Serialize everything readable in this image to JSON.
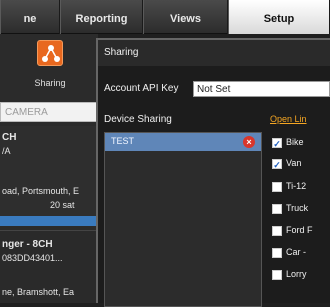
{
  "tabs": {
    "home": "ne",
    "reporting": "Reporting",
    "views": "Views",
    "setup": "Setup"
  },
  "left": {
    "sharing_label": "Sharing",
    "search_placeholder": "CAMERA",
    "device1": {
      "title": "CH",
      "line2": "/A",
      "line3": "oad, Portsmouth, E",
      "line4": "20 sat"
    },
    "device2": {
      "title": "nger - 8CH",
      "line2": "083DD43401...",
      "line3": "ne, Bramshott, Ea"
    }
  },
  "dialog": {
    "title": "Sharing",
    "api_key_label": "Account API Key",
    "api_key_value": "Not Set",
    "device_sharing_label": "Device Sharing",
    "open_link": "Open Lin",
    "shares": [
      "TEST"
    ],
    "checkboxes": [
      {
        "label": "Bike",
        "checked": true
      },
      {
        "label": "Van",
        "checked": true
      },
      {
        "label": "Ti-12",
        "checked": false
      },
      {
        "label": "Truck",
        "checked": false
      },
      {
        "label": "Ford F",
        "checked": false
      },
      {
        "label": "Car -",
        "checked": false
      },
      {
        "label": "Lorry",
        "checked": false
      }
    ]
  },
  "colors": {
    "accent_orange": "#e8681f",
    "selection_blue": "#5f86b8",
    "remove_red": "#d9362b",
    "link_orange": "#f5a623"
  }
}
